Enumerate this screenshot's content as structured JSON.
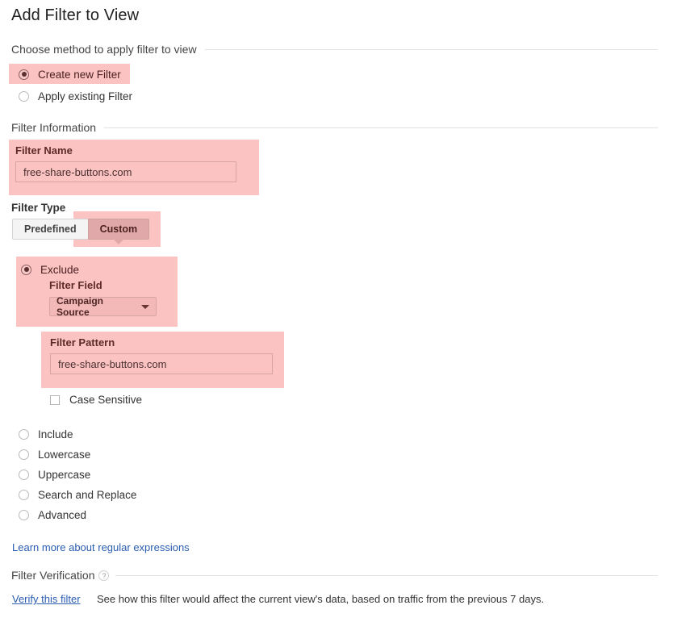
{
  "page": {
    "title": "Add Filter to View"
  },
  "method_section": {
    "heading": "Choose method to apply filter to view",
    "options": [
      {
        "label": "Create new Filter",
        "selected": true,
        "highlighted": true
      },
      {
        "label": "Apply existing Filter",
        "selected": false,
        "highlighted": false
      }
    ]
  },
  "filter_information": {
    "heading": "Filter Information",
    "filter_name": {
      "label": "Filter Name",
      "value": "free-share-buttons.com",
      "placeholder": ""
    },
    "filter_type": {
      "label": "Filter Type",
      "tabs": [
        {
          "label": "Predefined",
          "selected": false
        },
        {
          "label": "Custom",
          "selected": true
        }
      ]
    }
  },
  "custom_filter": {
    "exclude": {
      "label": "Exclude",
      "selected": true,
      "filter_field": {
        "label": "Filter Field",
        "selected_option": "Campaign Source",
        "caret_icon": "chevron-down-icon"
      },
      "filter_pattern": {
        "label": "Filter Pattern",
        "value": "free-share-buttons.com",
        "placeholder": ""
      },
      "case_sensitive": {
        "label": "Case Sensitive",
        "checked": false
      }
    },
    "other_options": [
      {
        "label": "Include",
        "selected": false
      },
      {
        "label": "Lowercase",
        "selected": false
      },
      {
        "label": "Uppercase",
        "selected": false
      },
      {
        "label": "Search and Replace",
        "selected": false
      },
      {
        "label": "Advanced",
        "selected": false
      }
    ]
  },
  "links": {
    "regex_help": "Learn more about regular expressions"
  },
  "filter_verification": {
    "heading": "Filter Verification",
    "help_icon": "question-mark-icon",
    "help_glyph": "?",
    "verify_link": "Verify this filter",
    "description": "See how this filter would affect the current view's data, based on traffic from the previous 7 days."
  },
  "colors": {
    "highlight": "#fcc3c3",
    "highlight_strong": "#e0a8a8",
    "link": "#2a5db0",
    "label_dark_red": "#5d2a2a",
    "divider": "#e3e3e3"
  }
}
